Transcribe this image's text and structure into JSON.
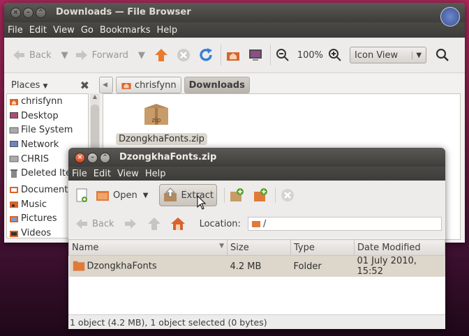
{
  "browser": {
    "title": "Downloads — File Browser",
    "menu": [
      "File",
      "Edit",
      "View",
      "Go",
      "Bookmarks",
      "Help"
    ],
    "toolbar": {
      "back": "Back",
      "forward": "Forward",
      "zoom": "100%",
      "view": "Icon View"
    },
    "places_label": "Places",
    "breadcrumbs": [
      "chrisfynn",
      "Downloads"
    ],
    "sidebar": [
      {
        "label": "chrisfynn",
        "icon": "home-icon"
      },
      {
        "label": "Desktop",
        "icon": "desktop-icon"
      },
      {
        "label": "File System",
        "icon": "drive-icon"
      },
      {
        "label": "Network",
        "icon": "network-icon"
      },
      {
        "label": "CHRIS",
        "icon": "drive-icon"
      },
      {
        "label": "Deleted Items",
        "icon": "trash-icon"
      },
      {
        "label": "Documents",
        "icon": "folder-icon"
      },
      {
        "label": "Music",
        "icon": "music-icon"
      },
      {
        "label": "Pictures",
        "icon": "pictures-icon"
      },
      {
        "label": "Videos",
        "icon": "video-icon"
      }
    ],
    "file": {
      "name": "DzongkhaFonts.zip",
      "badge": "zip"
    }
  },
  "archive": {
    "title": "DzongkhaFonts.zip",
    "menu": [
      "File",
      "Edit",
      "View",
      "Help"
    ],
    "toolbar": {
      "open": "Open",
      "extract": "Extract"
    },
    "nav": {
      "back": "Back",
      "location_label": "Location:",
      "location_value": "/"
    },
    "columns": [
      "Name",
      "Size",
      "Type",
      "Date Modified"
    ],
    "rows": [
      {
        "name": "DzongkhaFonts",
        "size": "4.2 MB",
        "type": "Folder",
        "date": "01 July 2010, 15:52"
      }
    ],
    "status": "1 object (4.2 MB), 1 object selected (0 bytes)"
  },
  "colors": {
    "accent": "#e07a3a",
    "titlebar": "#3e3d39",
    "selection": "#dcd6cb"
  }
}
